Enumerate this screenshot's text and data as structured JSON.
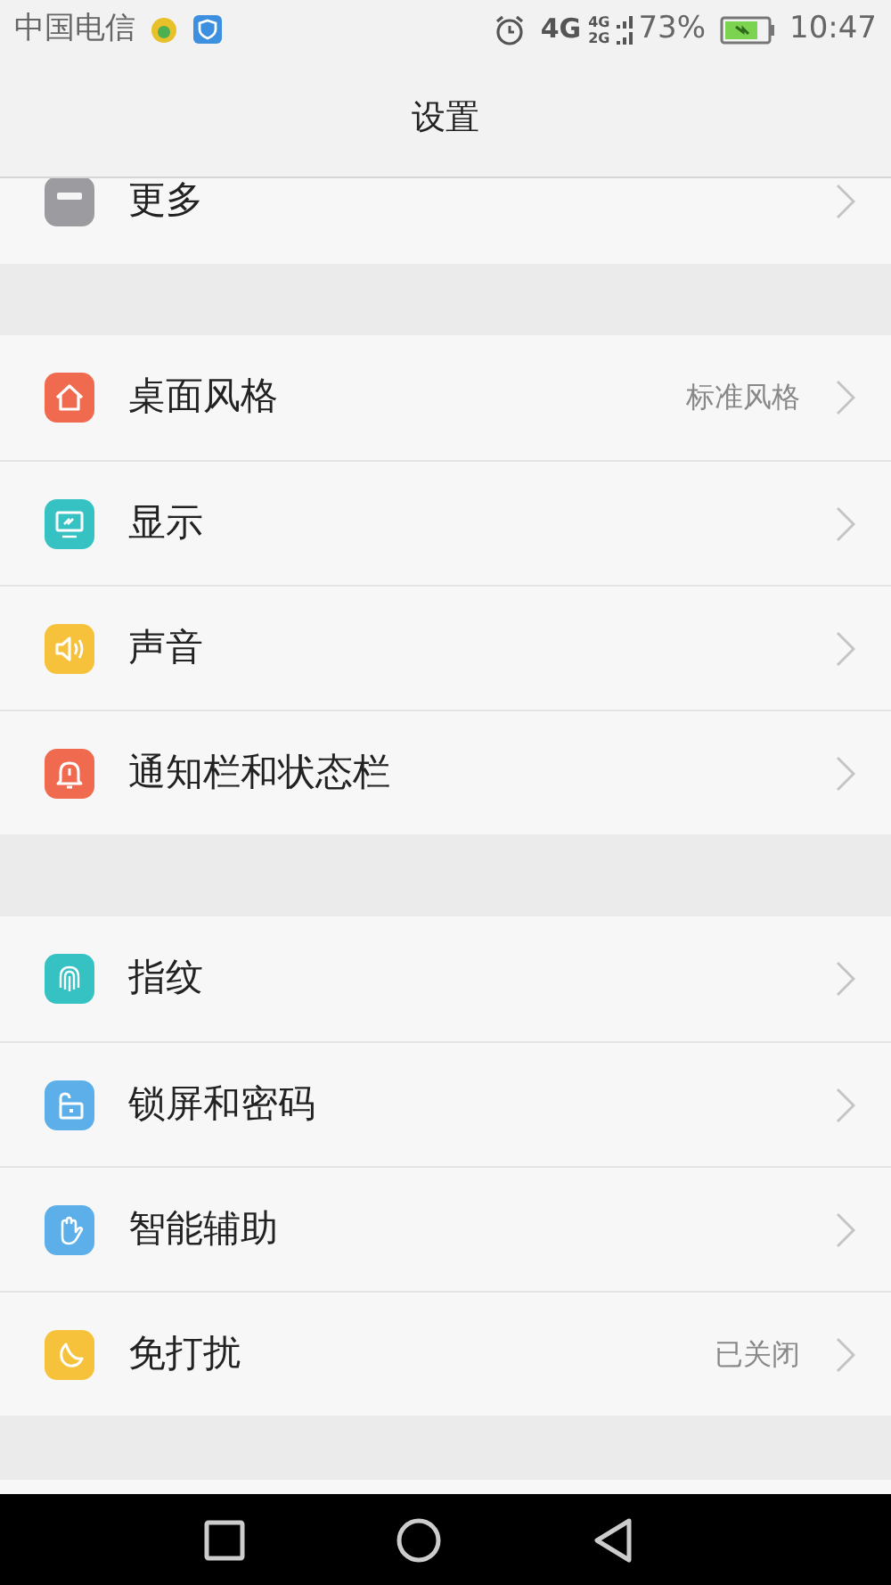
{
  "status_bar": {
    "carrier": "中国电信",
    "network": "4G",
    "sub_network_top": "4G",
    "sub_network_bottom": "2G",
    "battery": "73%",
    "time": "10:47"
  },
  "header": {
    "title": "设置"
  },
  "sections": [
    {
      "items": [
        {
          "label": "更多",
          "color": "#9b9ba0"
        }
      ]
    },
    {
      "items": [
        {
          "label": "桌面风格",
          "value": "标准风格",
          "color": "#f06a50"
        },
        {
          "label": "显示",
          "color": "#36c1c2"
        },
        {
          "label": "声音",
          "color": "#f7c23b"
        },
        {
          "label": "通知栏和状态栏",
          "color": "#f06a50"
        }
      ]
    },
    {
      "items": [
        {
          "label": "指纹",
          "color": "#36c1c2"
        },
        {
          "label": "锁屏和密码",
          "color": "#5cafe9"
        },
        {
          "label": "智能辅助",
          "color": "#5cafe9"
        },
        {
          "label": "免打扰",
          "value": "已关闭",
          "color": "#f7c23b"
        }
      ]
    }
  ]
}
